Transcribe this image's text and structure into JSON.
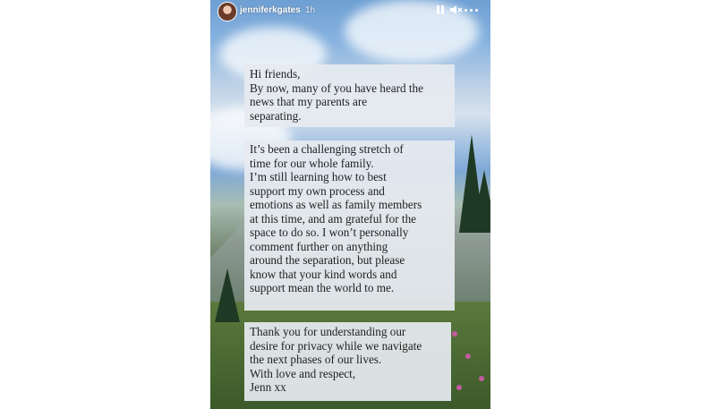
{
  "story": {
    "username": "jenniferkgates",
    "time": "1h",
    "controls": {
      "pause": "pause-icon",
      "mute": "volume-mute-icon",
      "more": "more-options-icon"
    }
  },
  "message": {
    "block1": [
      "Hi friends,",
      "By now, many of you have heard the",
      "news that my parents are",
      "separating."
    ],
    "block2": [
      "It’s been a challenging stretch of",
      "time for our whole family.",
      "I’m still learning how to best",
      "support my own process and",
      "emotions as well as family members",
      "at this time, and am grateful for the",
      "space to do so. I won’t personally",
      "comment further on anything",
      "around the separation, but please",
      "know that your kind words and",
      "support mean the world to me."
    ],
    "block3": [
      "Thank you for understanding our",
      "desire for privacy while we navigate",
      "the next phases of our lives.",
      "With love and respect,",
      "Jenn xx"
    ]
  }
}
